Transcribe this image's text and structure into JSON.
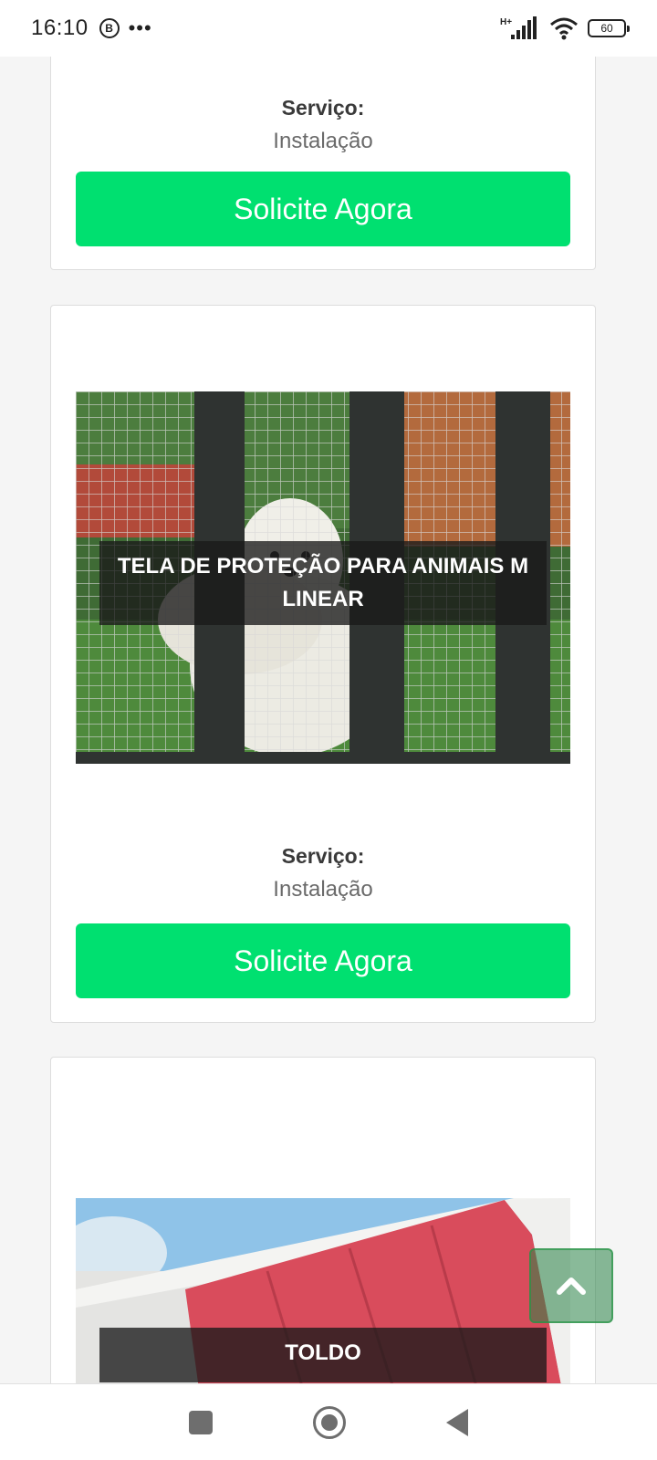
{
  "status_bar": {
    "time": "16:10",
    "notification_badge": "B",
    "more_indicator": "•••",
    "network": "H+",
    "battery": "60"
  },
  "cards": [
    {
      "service_label": "Serviço:",
      "service_value": "Instalação",
      "button_label": "Solicite Agora"
    },
    {
      "product_title": "TELA DE PROTEÇÃO PARA ANIMAIS M LINEAR",
      "service_label": "Serviço:",
      "service_value": "Instalação",
      "button_label": "Solicite Agora"
    },
    {
      "product_title": "TOLDO"
    }
  ],
  "colors": {
    "cta_green": "#00e070",
    "background": "#f5f5f5"
  },
  "icons": {
    "back_to_top": "chevron-up-icon",
    "nav_recents": "square-icon",
    "nav_home": "circle-icon",
    "nav_back": "triangle-back-icon"
  }
}
